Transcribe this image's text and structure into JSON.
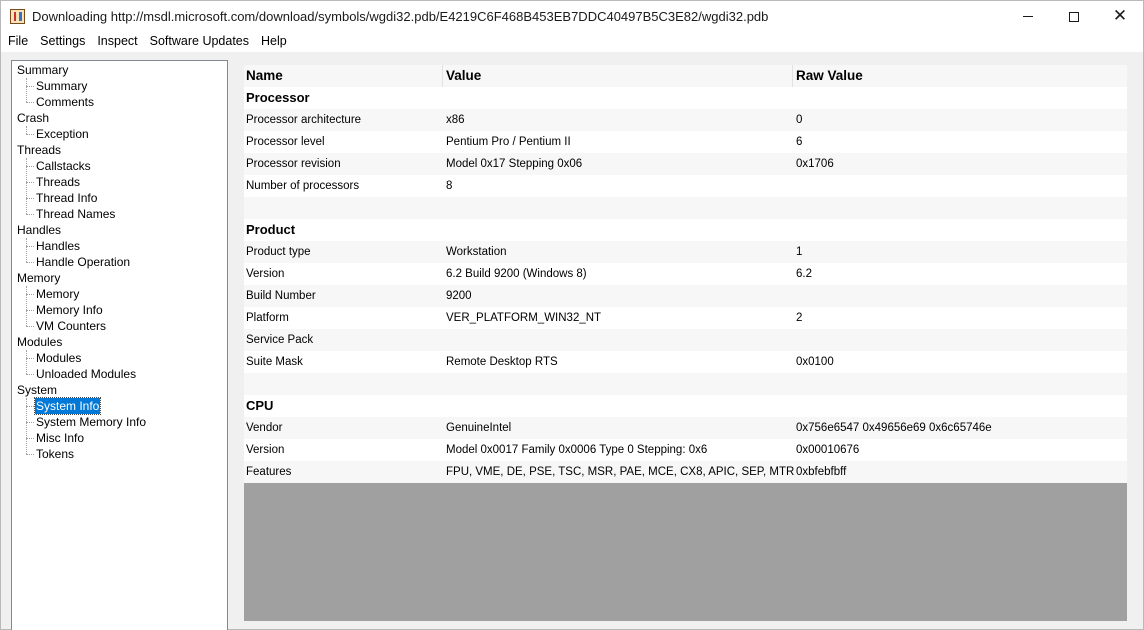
{
  "window": {
    "title": "Downloading http://msdl.microsoft.com/download/symbols/wgdi32.pdb/E4219C6F468B453EB7DDC40497B5C3E82/wgdi32.pdb"
  },
  "menu": [
    "File",
    "Settings",
    "Inspect",
    "Software Updates",
    "Help"
  ],
  "tree": [
    {
      "label": "Summary",
      "children": [
        "Summary",
        "Comments"
      ]
    },
    {
      "label": "Crash",
      "children": [
        "Exception"
      ]
    },
    {
      "label": "Threads",
      "children": [
        "Callstacks",
        "Threads",
        "Thread Info",
        "Thread Names"
      ]
    },
    {
      "label": "Handles",
      "children": [
        "Handles",
        "Handle Operation"
      ]
    },
    {
      "label": "Memory",
      "children": [
        "Memory",
        "Memory Info",
        "VM Counters"
      ]
    },
    {
      "label": "Modules",
      "children": [
        "Modules",
        "Unloaded Modules"
      ]
    },
    {
      "label": "System",
      "children": [
        "System Info",
        "System Memory Info",
        "Misc Info",
        "Tokens"
      ]
    }
  ],
  "selected_item": "System Info",
  "table": {
    "headers": {
      "name": "Name",
      "value": "Value",
      "raw": "Raw Value"
    },
    "rows": [
      {
        "section": "Processor"
      },
      {
        "name": "Processor architecture",
        "value": "x86",
        "raw": "0"
      },
      {
        "name": "Processor level",
        "value": "Pentium Pro / Pentium II",
        "raw": "6"
      },
      {
        "name": "Processor revision",
        "value": "Model 0x17 Stepping 0x06",
        "raw": "0x1706"
      },
      {
        "name": "Number of processors",
        "value": "8",
        "raw": ""
      },
      {
        "blank": true
      },
      {
        "section": "Product"
      },
      {
        "name": "Product type",
        "value": "Workstation",
        "raw": "1"
      },
      {
        "name": "Version",
        "value": "6.2 Build 9200 (Windows 8)",
        "raw": "6.2"
      },
      {
        "name": "Build Number",
        "value": "9200",
        "raw": ""
      },
      {
        "name": "Platform",
        "value": "VER_PLATFORM_WIN32_NT",
        "raw": "2"
      },
      {
        "name": "Service Pack",
        "value": "",
        "raw": ""
      },
      {
        "name": "Suite Mask",
        "value": "Remote Desktop RTS",
        "raw": "0x0100"
      },
      {
        "blank": true
      },
      {
        "section": "CPU"
      },
      {
        "name": "Vendor",
        "value": "GenuineIntel",
        "raw": "0x756e6547 0x49656e69 0x6c65746e"
      },
      {
        "name": "Version",
        "value": "Model 0x0017 Family 0x0006 Type 0 Stepping: 0x6",
        "raw": "0x00010676"
      },
      {
        "name": "Features",
        "value": "FPU, VME, DE, PSE, TSC, MSR, PAE, MCE, CX8, APIC, SEP, MTRR, PGE, MCA",
        "raw": "0xbfebfbff"
      }
    ]
  },
  "colors": {
    "selection": "#0078d7",
    "empty_area": "#a0a0a0"
  }
}
